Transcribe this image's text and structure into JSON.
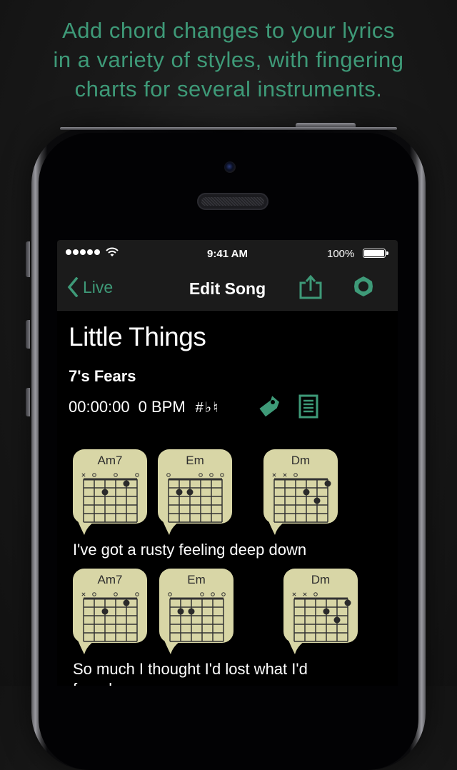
{
  "tagline": {
    "lines": [
      "Add chord changes to your lyrics",
      "in a variety of styles, with fingering",
      "charts for several instruments."
    ]
  },
  "status_bar": {
    "time": "9:41 AM",
    "battery_percent": "100%",
    "signal_dots": 5,
    "battery_level": 1.0
  },
  "nav": {
    "back_label": "Live",
    "title": "Edit Song",
    "share_icon": "share-icon",
    "settings_icon": "gear-icon"
  },
  "song": {
    "title": "Little Things",
    "artist": "7's Fears",
    "duration": "00:00:00",
    "bpm": "0 BPM",
    "key_symbol": "#♭♮",
    "tag_icon": "tag-icon",
    "notes_icon": "notes-icon"
  },
  "colors": {
    "accent": "#3e9a78",
    "chord_bubble": "#d8d6a6",
    "bar_background": "#1b1b1b"
  },
  "lines": [
    {
      "lyric": "I've got a rusty feeling deep down",
      "chords": [
        {
          "name": "Am7",
          "open": [
            "x",
            "o",
            "",
            "o",
            "",
            "o"
          ],
          "dots": [
            [
              2,
              2
            ],
            [
              4,
              1
            ]
          ]
        },
        {
          "name": "Em",
          "open": [
            "o",
            "",
            "",
            "o",
            "o",
            "o"
          ],
          "dots": [
            [
              1,
              2
            ],
            [
              2,
              2
            ]
          ]
        },
        {
          "name": "Dm",
          "open": [
            "x",
            "x",
            "o",
            "",
            "",
            ""
          ],
          "dots": [
            [
              5,
              1
            ],
            [
              3,
              2
            ],
            [
              4,
              3
            ]
          ]
        }
      ]
    },
    {
      "lyric": "So much I thought I'd lost what I'd",
      "lyric_cont": "found",
      "chords": [
        {
          "name": "Am7",
          "open": [
            "x",
            "o",
            "",
            "o",
            "",
            "o"
          ],
          "dots": [
            [
              2,
              2
            ],
            [
              4,
              1
            ]
          ]
        },
        {
          "name": "Em",
          "open": [
            "o",
            "",
            "",
            "o",
            "o",
            "o"
          ],
          "dots": [
            [
              1,
              2
            ],
            [
              2,
              2
            ]
          ]
        },
        {
          "name": "Dm",
          "open": [
            "x",
            "x",
            "o",
            "",
            "",
            ""
          ],
          "dots": [
            [
              5,
              1
            ],
            [
              3,
              2
            ],
            [
              4,
              3
            ]
          ]
        }
      ]
    }
  ]
}
